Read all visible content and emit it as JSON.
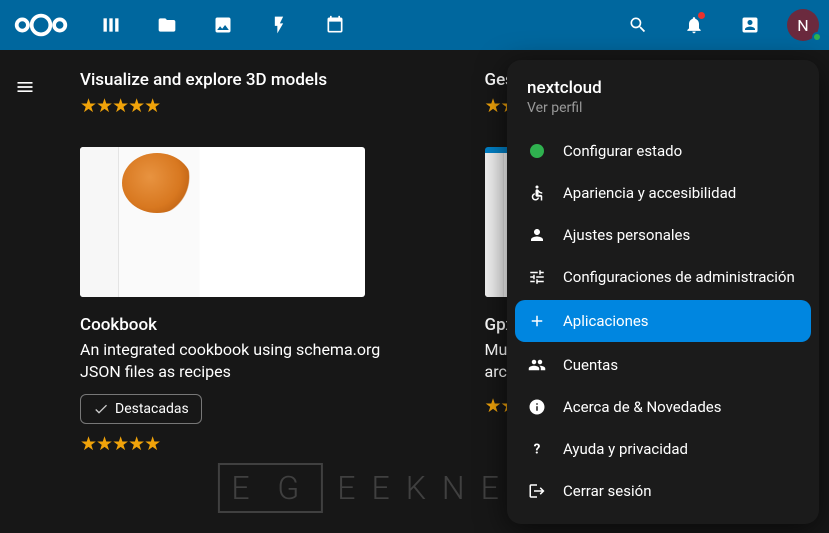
{
  "avatar_initial": "N",
  "apps": {
    "left1": {
      "title": "Visualize and explore 3D models",
      "stars": "★★★★★"
    },
    "right1": {
      "title": "Gestor d",
      "stars": "★★★★"
    },
    "left2": {
      "title": "Cookbook",
      "desc": "An integrated cookbook using schema.org JSON files as recipes",
      "badge": "Destacadas",
      "stars": "★★★★★"
    },
    "right2": {
      "title": "GpxPod",
      "desc": "Muestra,\narchivos",
      "stars": "★★★★"
    }
  },
  "dropdown": {
    "user": "nextcloud",
    "sub": "Ver perfil",
    "items": [
      {
        "label": "Configurar estado",
        "icon": "status"
      },
      {
        "label": "Apariencia y accesibilidad",
        "icon": "accessibility"
      },
      {
        "label": "Ajustes personales",
        "icon": "person"
      },
      {
        "label": "Configuraciones de administración",
        "icon": "tune"
      },
      {
        "label": "Aplicaciones",
        "icon": "plus",
        "active": true
      },
      {
        "label": "Cuentas",
        "icon": "group"
      },
      {
        "label": "Acerca de & Novedades",
        "icon": "info"
      },
      {
        "label": "Ayuda y privacidad",
        "icon": "help"
      },
      {
        "label": "Cerrar sesión",
        "icon": "logout"
      }
    ]
  },
  "watermark": {
    "bracket": "E G",
    "rest": "EEKNETIC"
  }
}
